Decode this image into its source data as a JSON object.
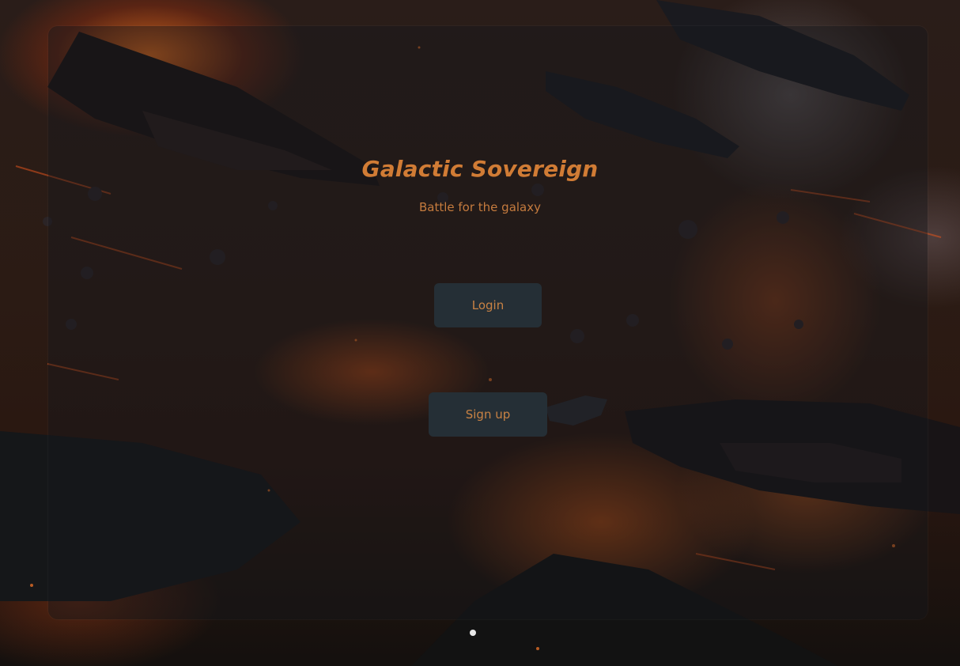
{
  "title": "Galactic Sovereign",
  "subtitle": "Battle for the galaxy",
  "buttons": {
    "login": "Login",
    "signup": "Sign up"
  },
  "colors": {
    "accent": "#d17c35",
    "button_bg": "#252f36"
  }
}
